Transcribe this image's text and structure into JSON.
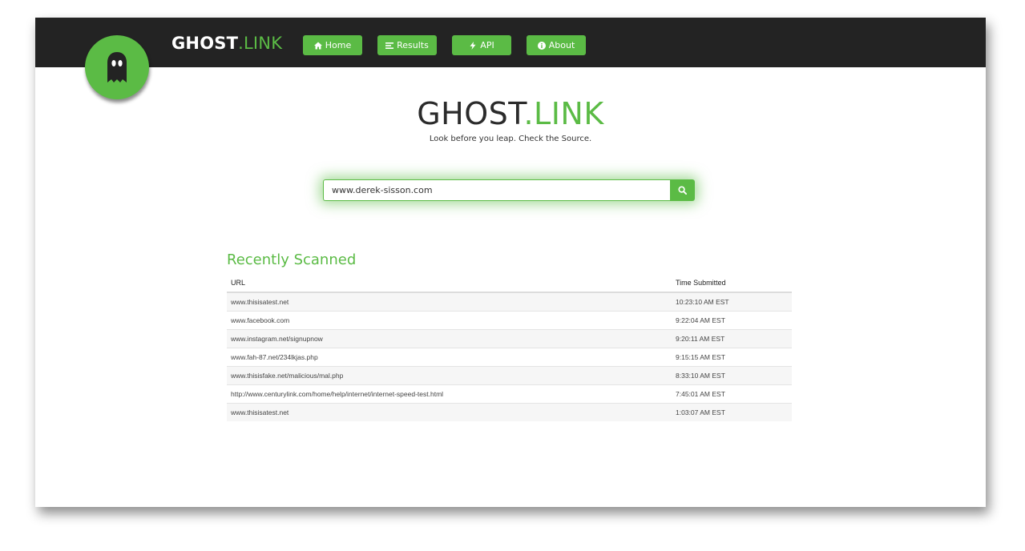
{
  "header": {
    "brand_main": "GHOST",
    "brand_accent": ".LINK",
    "nav": [
      {
        "label": "Home",
        "icon": "home-icon"
      },
      {
        "label": "Results",
        "icon": "list-icon"
      },
      {
        "label": "API",
        "icon": "bolt-icon"
      },
      {
        "label": "About",
        "icon": "info-icon"
      }
    ]
  },
  "hero": {
    "title_main": "GHOST",
    "title_accent": ".LINK",
    "tagline": "Look before you leap. Check the Source."
  },
  "search": {
    "value": "www.derek-sisson.com",
    "button_icon": "search-icon"
  },
  "recent": {
    "title": "Recently Scanned",
    "columns": [
      "URL",
      "Time Submitted"
    ],
    "rows": [
      {
        "url": "www.thisisatest.net",
        "time": "10:23:10 AM EST"
      },
      {
        "url": "www.facebook.com",
        "time": "9:22:04 AM EST"
      },
      {
        "url": "www.instagram.net/signupnow",
        "time": "9:20:11 AM EST"
      },
      {
        "url": "www.fah-87.net/234lkjas.php",
        "time": "9:15:15 AM EST"
      },
      {
        "url": "www.thisisfake.net/malicious/mal.php",
        "time": "8:33:10 AM EST"
      },
      {
        "url": "http://www.centurylink.com/home/help/internet/internet-speed-test.html",
        "time": "7:45:01 AM EST"
      },
      {
        "url": "www.thisisatest.net",
        "time": "1:03:07 AM EST"
      }
    ]
  },
  "colors": {
    "accent": "#5bbb45",
    "navbar": "#232323"
  }
}
